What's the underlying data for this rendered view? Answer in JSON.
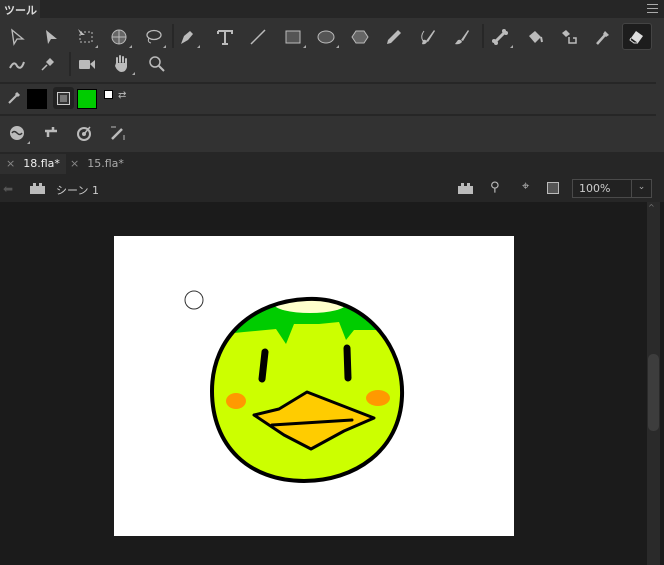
{
  "panel": {
    "title": "ツール"
  },
  "colors": {
    "stroke": "#000000",
    "fill": "#00cc00"
  },
  "document_tabs": [
    {
      "label": "18.fla*",
      "active": true
    },
    {
      "label": "15.fla*",
      "active": false
    }
  ],
  "edit_bar": {
    "scene": "シーン 1",
    "zoom": "100%"
  }
}
